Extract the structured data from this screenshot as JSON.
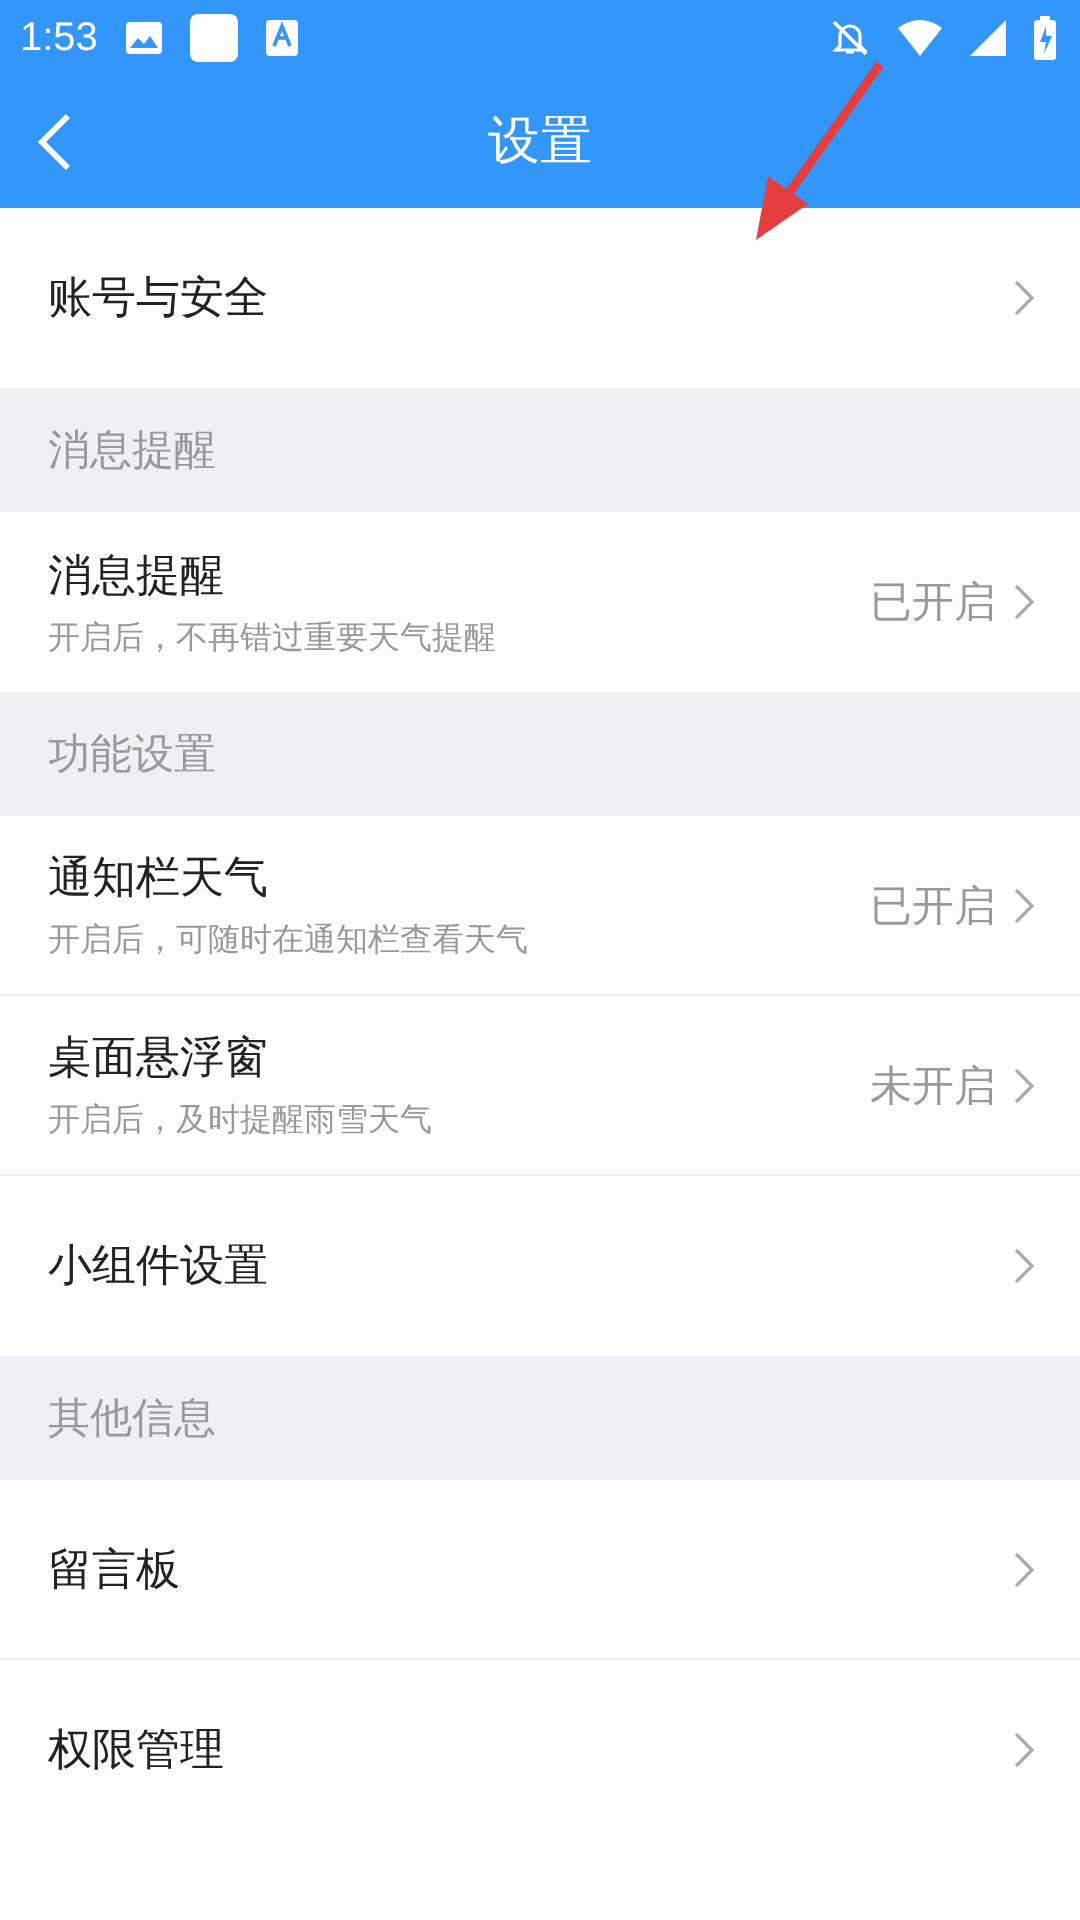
{
  "status_bar": {
    "time": "1:53"
  },
  "nav": {
    "title": "设置"
  },
  "sections": [
    {
      "items": [
        {
          "title": "账号与安全"
        }
      ]
    },
    {
      "header": "消息提醒",
      "items": [
        {
          "title": "消息提醒",
          "subtitle": "开启后，不再错过重要天气提醒",
          "status": "已开启"
        }
      ]
    },
    {
      "header": "功能设置",
      "items": [
        {
          "title": "通知栏天气",
          "subtitle": "开启后，可随时在通知栏查看天气",
          "status": "已开启"
        },
        {
          "title": "桌面悬浮窗",
          "subtitle": "开启后，及时提醒雨雪天气",
          "status": "未开启"
        },
        {
          "title": "小组件设置"
        }
      ]
    },
    {
      "header": "其他信息",
      "items": [
        {
          "title": "留言板"
        },
        {
          "title": "权限管理"
        }
      ]
    }
  ]
}
